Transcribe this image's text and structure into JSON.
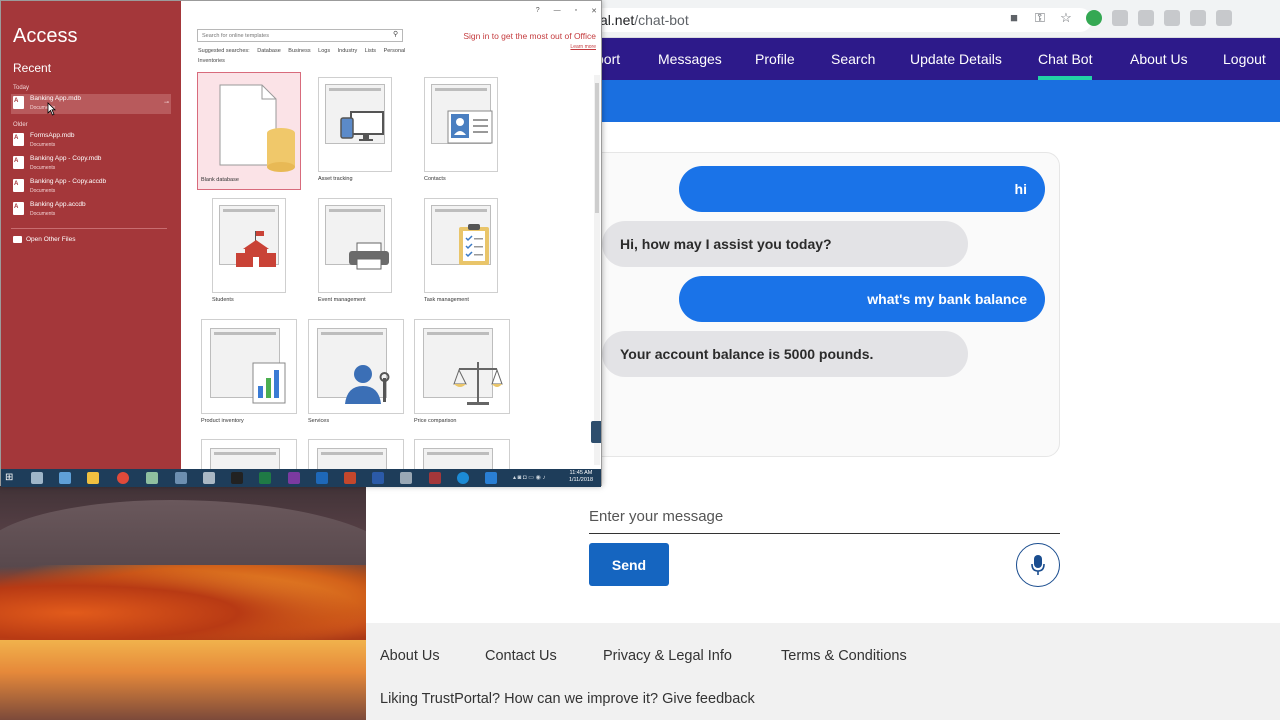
{
  "browser": {
    "url_host": "al.net",
    "url_path": "/chat-bot",
    "nav": [
      {
        "label": "port",
        "active": false
      },
      {
        "label": "Messages",
        "active": false
      },
      {
        "label": "Profile",
        "active": false
      },
      {
        "label": "Search",
        "active": false
      },
      {
        "label": "Update Details",
        "active": false
      },
      {
        "label": "Chat Bot",
        "active": true
      },
      {
        "label": "About Us",
        "active": false
      },
      {
        "label": "Logout",
        "active": false
      }
    ],
    "colors": {
      "nav_bg": "#2d1a8a",
      "hero_band": "#1a6fe0",
      "active_underline": "#22d3a6",
      "user_bubble": "#1a73e8",
      "send_button": "#1565c0"
    },
    "chat": [
      {
        "from": "user",
        "text": "hi"
      },
      {
        "from": "bot",
        "text": "Hi, how may I assist you today?"
      },
      {
        "from": "user",
        "text": "what's my bank balance"
      },
      {
        "from": "bot",
        "text": "Your account balance is 5000 pounds."
      }
    ],
    "message_placeholder": "Enter your message",
    "send_label": "Send",
    "footer_links": [
      "About Us",
      "Contact Us",
      "Privacy & Legal Info",
      "Terms & Conditions"
    ],
    "feedback_text": "Liking TrustPortal? How can we improve it? Give feedback"
  },
  "access": {
    "app_title": "Access",
    "recent_title": "Recent",
    "today_label": "Today",
    "older_label": "Older",
    "recent_today": [
      {
        "name": "Banking App.mdb",
        "path": "Documents"
      }
    ],
    "recent_older": [
      {
        "name": "FormsApp.mdb",
        "path": "Documents"
      },
      {
        "name": "Banking App - Copy.mdb",
        "path": "Documents"
      },
      {
        "name": "Banking App - Copy.accdb",
        "path": "Documents"
      },
      {
        "name": "Banking App.accdb",
        "path": "Documents"
      }
    ],
    "open_other_files": "Open Other Files",
    "window_controls": [
      "?",
      "—",
      "▫",
      "✕"
    ],
    "search_placeholder": "Search for online templates",
    "suggested_label": "Suggested searches:",
    "suggested": [
      "Database",
      "Business",
      "Logs",
      "Industry",
      "Lists",
      "Personal"
    ],
    "suggested_second_line": "Inventories",
    "signin_text": "Sign in to get the most out of Office",
    "learn_more": "Learn more",
    "templates": [
      {
        "name": "Blank database",
        "selected": true
      },
      {
        "name": "Asset tracking",
        "selected": false
      },
      {
        "name": "Contacts",
        "selected": false
      },
      {
        "name": "Students",
        "selected": false
      },
      {
        "name": "Event management",
        "selected": false
      },
      {
        "name": "Task management",
        "selected": false
      },
      {
        "name": "Product inventory",
        "selected": false
      },
      {
        "name": "Services",
        "selected": false
      },
      {
        "name": "Price comparison",
        "selected": false
      }
    ],
    "theme_color": "#a4373a"
  },
  "taskbar": {
    "time": "11:45 AM",
    "date": "1/11/2018"
  }
}
